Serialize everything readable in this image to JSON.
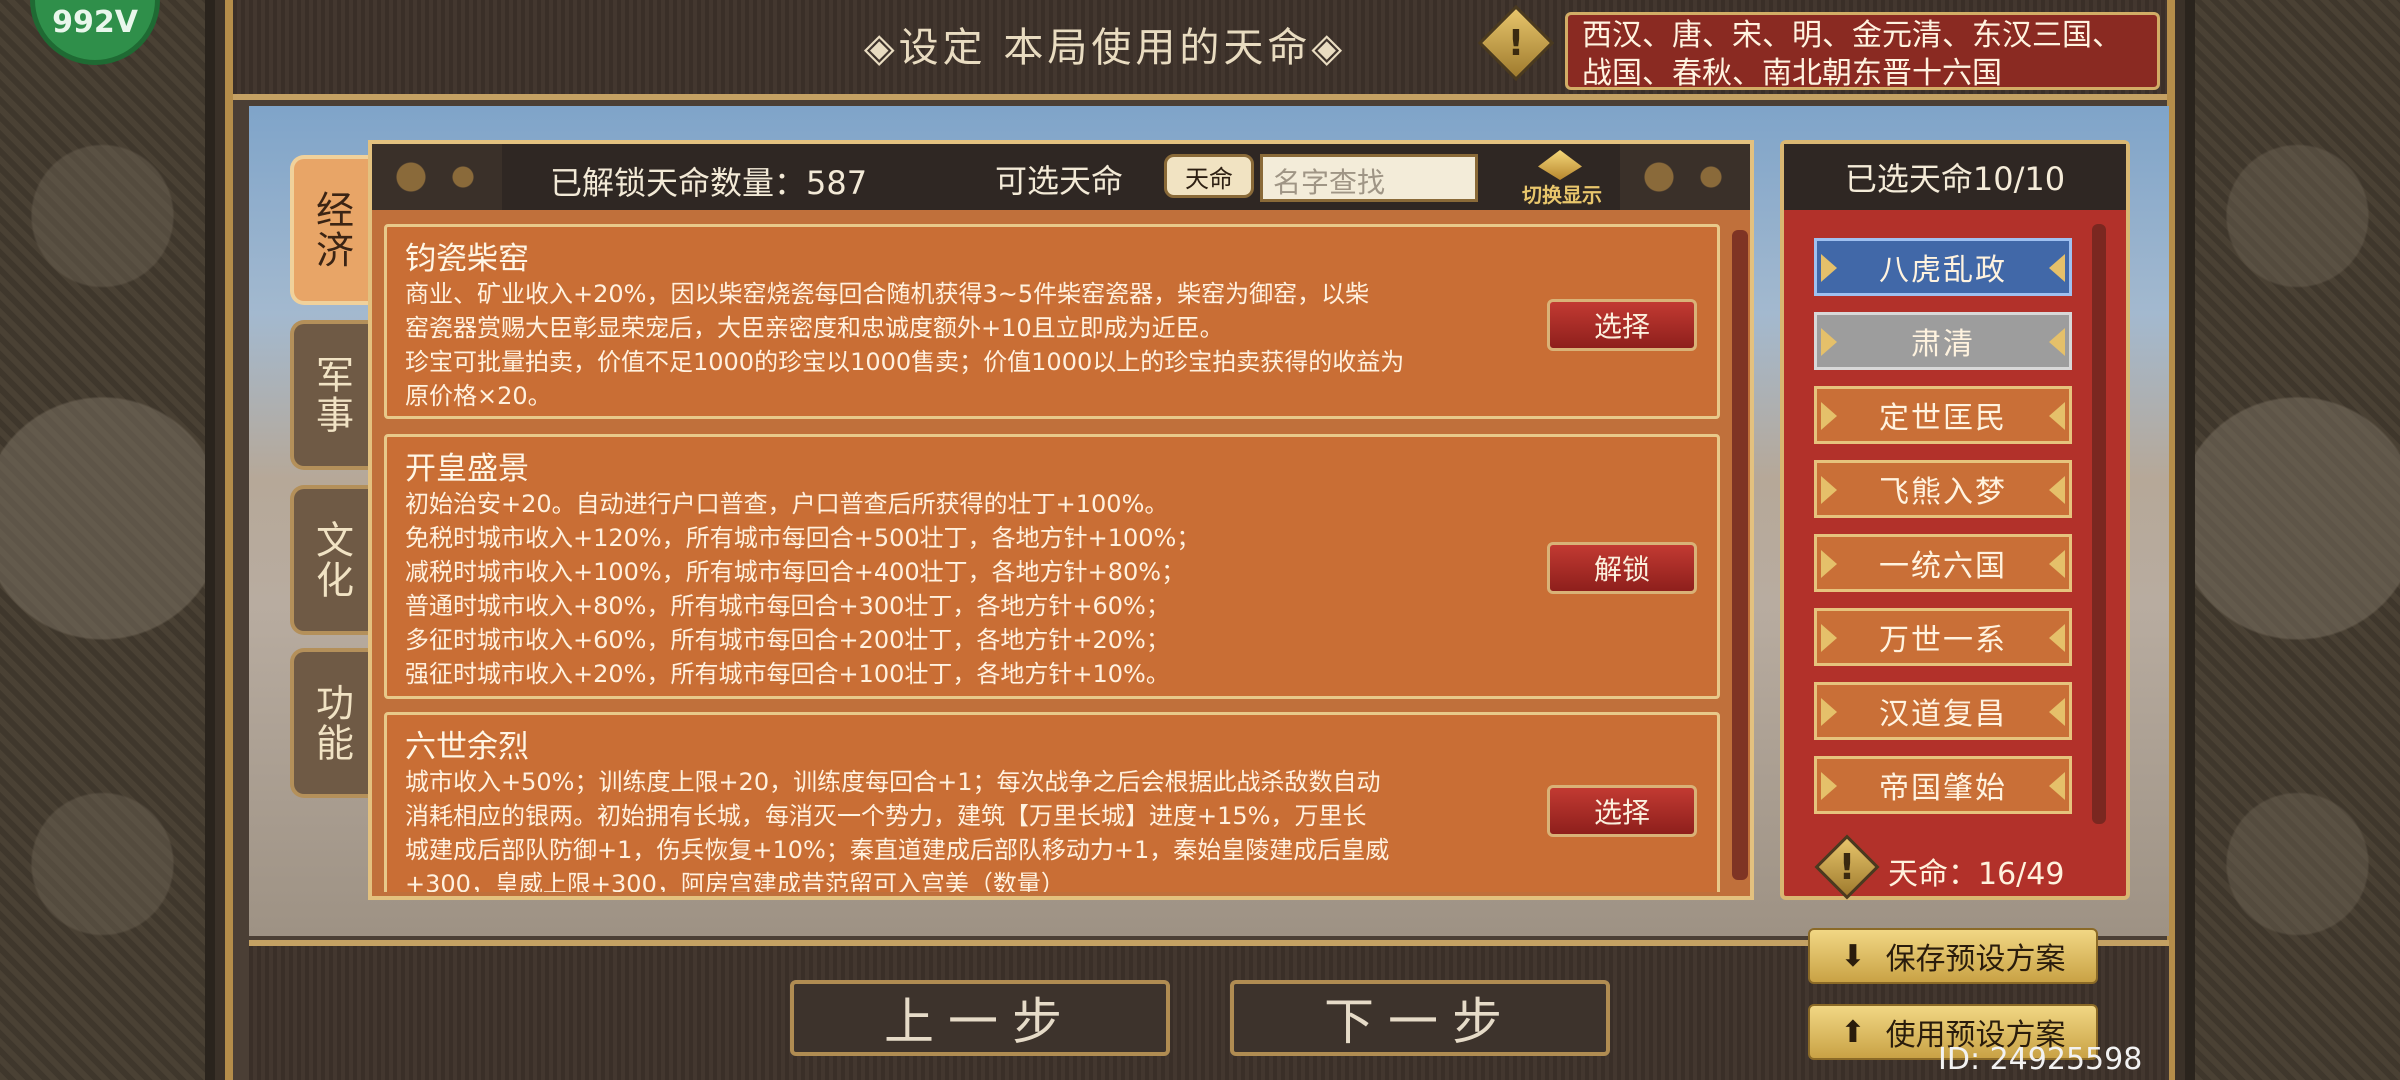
{
  "badge": "992V",
  "title": "◈设定 本局使用的天命◈",
  "dynasty_text": "西汉、唐、宋、明、金元清、东汉三国、战国、春秋、南北朝东晋十六国",
  "categories": [
    "经济",
    "军事",
    "文化",
    "功能"
  ],
  "header": {
    "unlocked": "已解锁天命数量：587",
    "selectable": "可选天命",
    "tag": "天命",
    "search_placeholder": "名字查找",
    "switch_display": "切换显示"
  },
  "cards": [
    {
      "title": "钧瓷柴窑",
      "desc": "商业、矿业收入+20%，因以柴窑烧瓷每回合随机获得3~5件柴窑瓷器，柴窑为御窑，以柴\n窑瓷器赏赐大臣彰显荣宠后，大臣亲密度和忠诚度额外+10且立即成为近臣。\n珍宝可批量拍卖，价值不足1000的珍宝以1000售卖；价值1000以上的珍宝拍卖获得的收益为\n原价格×20。",
      "button": "选择"
    },
    {
      "title": "开皇盛景",
      "desc": "初始治安+20。自动进行户口普查，户口普查后所获得的壮丁+100%。\n免税时城市收入+120%，所有城市每回合+500壮丁，各地方针+100%；\n减税时城市收入+100%，所有城市每回合+400壮丁，各地方针+80%；\n普通时城市收入+80%，所有城市每回合+300壮丁，各地方针+60%；\n多征时城市收入+60%，所有城市每回合+200壮丁，各地方针+20%；\n强征时城市收入+20%，所有城市每回合+100壮丁，各地方针+10%。",
      "button": "解锁"
    },
    {
      "title": "六世余烈",
      "desc": "城市收入+50%；训练度上限+20，训练度每回合+1；每次战争之后会根据此战杀敌数自动\n消耗相应的银两。初始拥有长城，每消灭一个势力，建筑【万里长城】进度+15%，万里长\n城建成后部队防御+1，伤兵恢复+10%；秦直道建成后部队移动力+1，秦始皇陵建成后皇威\n+300，皇威上限+300，阿房宫建成昔范留可入宫美（数量）",
      "button": "选择"
    }
  ],
  "selected": {
    "header": "已选天命10/10",
    "items": [
      "八虎乱政",
      "肃清",
      "定世匡民",
      "飞熊入梦",
      "一统六国",
      "万世一系",
      "汉道复昌",
      "帝国肇始"
    ],
    "count": "天命：16/49"
  },
  "nav": {
    "prev": "上一步",
    "next": "下一步"
  },
  "presets": {
    "save": "保存预设方案",
    "use": "使用预设方案"
  },
  "id_label": "ID: 24925598",
  "colors": {
    "accent_gold": "#e3c17f",
    "card_orange": "#c96e35",
    "button_red": "#c23a32",
    "selected_blue": "#4168a8"
  }
}
